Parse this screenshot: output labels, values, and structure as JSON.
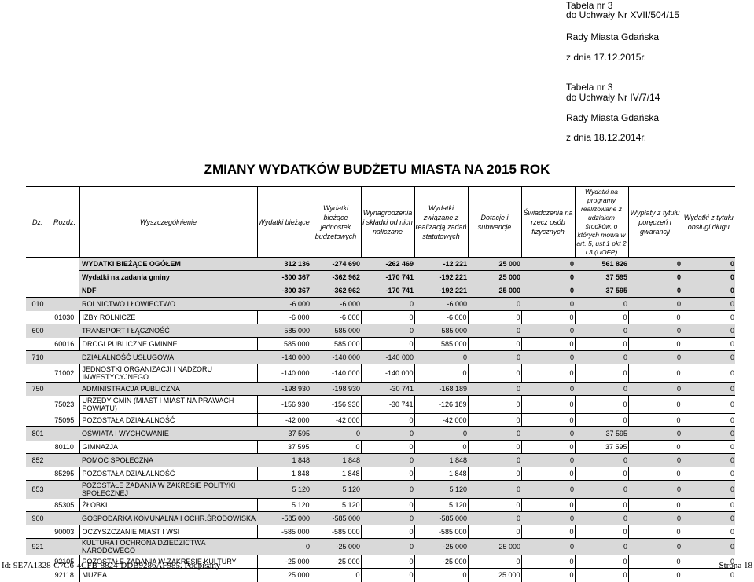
{
  "header": {
    "lines": [
      "Tabela nr 3",
      "do Uchwały Nr XVII/504/15",
      "Rady Miasta Gdańska",
      "z dnia 17.12.2015r.",
      "Tabela nr 3",
      "do Uchwały Nr IV/7/14",
      "Rady Miasta Gdańska",
      "z dnia 18.12.2014r."
    ]
  },
  "title": "ZMIANY WYDATKÓW  BUDŻETU MIASTA NA 2015 ROK",
  "columns": [
    "Dz.",
    "Rozdz.",
    "Wyszczególnienie",
    "Wydatki bieżące",
    "Wydatki bieżące jednostek budżetowych",
    "Wynagrodzenia i składki od nich naliczane",
    "Wydatki związane z realizacją zadań statutowych",
    "Dotacje i subwencje",
    "Świadczenia na rzecz osób fizycznych",
    "Wydatki na programy realizowane z udziałem środków, o których mowa w art. 5, ust.1 pkt 2 i 3 (UOFP)",
    "Wypłaty z tytułu poręczeń i gwarancji",
    "Wydatki z tytułu obsługi długu"
  ],
  "rows": [
    {
      "type": "sum",
      "dz": "",
      "rozdz": "",
      "name": "WYDATKI BIEŻĄCE OGÓŁEM",
      "v": [
        "312 136",
        "-274 690",
        "-262 469",
        "-12 221",
        "25 000",
        "0",
        "561 826",
        "0",
        "0"
      ]
    },
    {
      "type": "sum",
      "dz": "",
      "rozdz": "",
      "name": "Wydatki na zadania gminy",
      "v": [
        "-300 367",
        "-362 962",
        "-170 741",
        "-192 221",
        "25 000",
        "0",
        "37 595",
        "0",
        "0"
      ]
    },
    {
      "type": "sum",
      "dz": "",
      "rozdz": "",
      "name": "NDF",
      "v": [
        "-300 367",
        "-362 962",
        "-170 741",
        "-192 221",
        "25 000",
        "0",
        "37 595",
        "0",
        "0"
      ]
    },
    {
      "type": "sec",
      "dz": "010",
      "rozdz": "",
      "name": "ROLNICTWO I ŁOWIECTWO",
      "v": [
        "-6 000",
        "-6 000",
        "0",
        "-6 000",
        "0",
        "0",
        "0",
        "0",
        "0"
      ]
    },
    {
      "type": "sub",
      "dz": "",
      "rozdz": "01030",
      "name": "IZBY ROLNICZE",
      "v": [
        "-6 000",
        "-6 000",
        "0",
        "-6 000",
        "0",
        "0",
        "0",
        "0",
        "0"
      ]
    },
    {
      "type": "sec",
      "dz": "600",
      "rozdz": "",
      "name": "TRANSPORT I ŁĄCZNOŚĆ",
      "v": [
        "585 000",
        "585 000",
        "0",
        "585 000",
        "0",
        "0",
        "0",
        "0",
        "0"
      ]
    },
    {
      "type": "sub",
      "dz": "",
      "rozdz": "60016",
      "name": "DROGI PUBLICZNE GMINNE",
      "v": [
        "585 000",
        "585 000",
        "0",
        "585 000",
        "0",
        "0",
        "0",
        "0",
        "0"
      ]
    },
    {
      "type": "sec",
      "dz": "710",
      "rozdz": "",
      "name": "DZIAŁALNOŚĆ USŁUGOWA",
      "v": [
        "-140 000",
        "-140 000",
        "-140 000",
        "0",
        "0",
        "0",
        "0",
        "0",
        "0"
      ]
    },
    {
      "type": "sub",
      "dz": "",
      "rozdz": "71002",
      "name": "JEDNOSTKI ORGANIZACJI I NADZORU INWESTYCYJNEGO",
      "v": [
        "-140 000",
        "-140 000",
        "-140 000",
        "0",
        "0",
        "0",
        "0",
        "0",
        "0"
      ]
    },
    {
      "type": "sec",
      "dz": "750",
      "rozdz": "",
      "name": "ADMINISTRACJA PUBLICZNA",
      "v": [
        "-198 930",
        "-198 930",
        "-30 741",
        "-168 189",
        "0",
        "0",
        "0",
        "0",
        "0"
      ]
    },
    {
      "type": "sub",
      "dz": "",
      "rozdz": "75023",
      "name": "URZĘDY GMIN (MIAST I MIAST NA PRAWACH POWIATU)",
      "v": [
        "-156 930",
        "-156 930",
        "-30 741",
        "-126 189",
        "0",
        "0",
        "0",
        "0",
        "0"
      ]
    },
    {
      "type": "sub",
      "dz": "",
      "rozdz": "75095",
      "name": "POZOSTAŁA DZIAŁALNOŚĆ",
      "v": [
        "-42 000",
        "-42 000",
        "0",
        "-42 000",
        "0",
        "0",
        "0",
        "0",
        "0"
      ]
    },
    {
      "type": "sec",
      "dz": "801",
      "rozdz": "",
      "name": "OŚWIATA I WYCHOWANIE",
      "v": [
        "37 595",
        "0",
        "0",
        "0",
        "0",
        "0",
        "37 595",
        "0",
        "0"
      ]
    },
    {
      "type": "sub",
      "dz": "",
      "rozdz": "80110",
      "name": "GIMNAZJA",
      "v": [
        "37 595",
        "0",
        "0",
        "0",
        "0",
        "0",
        "37 595",
        "0",
        "0"
      ]
    },
    {
      "type": "sec",
      "dz": "852",
      "rozdz": "",
      "name": "POMOC SPOŁECZNA",
      "v": [
        "1 848",
        "1 848",
        "0",
        "1 848",
        "0",
        "0",
        "0",
        "0",
        "0"
      ]
    },
    {
      "type": "sub",
      "dz": "",
      "rozdz": "85295",
      "name": "POZOSTAŁA DZIAŁALNOŚĆ",
      "v": [
        "1 848",
        "1 848",
        "0",
        "1 848",
        "0",
        "0",
        "0",
        "0",
        "0"
      ]
    },
    {
      "type": "sec",
      "dz": "853",
      "rozdz": "",
      "name": "POZOSTAŁE ZADANIA W ZAKRESIE POLITYKI SPOŁECZNEJ",
      "v": [
        "5 120",
        "5 120",
        "0",
        "5 120",
        "0",
        "0",
        "0",
        "0",
        "0"
      ]
    },
    {
      "type": "sub",
      "dz": "",
      "rozdz": "85305",
      "name": "ŻŁOBKI",
      "v": [
        "5 120",
        "5 120",
        "0",
        "5 120",
        "0",
        "0",
        "0",
        "0",
        "0"
      ]
    },
    {
      "type": "sec",
      "dz": "900",
      "rozdz": "",
      "name": "GOSPODARKA KOMUNALNA I OCHR.ŚRODOWISKA",
      "v": [
        "-585 000",
        "-585 000",
        "0",
        "-585 000",
        "0",
        "0",
        "0",
        "0",
        "0"
      ]
    },
    {
      "type": "sub",
      "dz": "",
      "rozdz": "90003",
      "name": "OCZYSZCZANIE MIAST I WSI",
      "v": [
        "-585 000",
        "-585 000",
        "0",
        "-585 000",
        "0",
        "0",
        "0",
        "0",
        "0"
      ]
    },
    {
      "type": "sec",
      "dz": "921",
      "rozdz": "",
      "name": "KULTURA I OCHRONA DZIEDZICTWA NARODOWEGO",
      "v": [
        "0",
        "-25 000",
        "0",
        "-25 000",
        "25 000",
        "0",
        "0",
        "0",
        "0"
      ]
    },
    {
      "type": "sub",
      "dz": "",
      "rozdz": "92105",
      "name": "POZOSTAŁE ZADANIA W ZAKRESIE KULTURY",
      "v": [
        "-25 000",
        "-25 000",
        "0",
        "-25 000",
        "0",
        "0",
        "0",
        "0",
        "0"
      ]
    },
    {
      "type": "sub",
      "dz": "",
      "rozdz": "92118",
      "name": "MUZEA",
      "v": [
        "25 000",
        "0",
        "0",
        "0",
        "25 000",
        "0",
        "0",
        "0",
        "0"
      ]
    }
  ],
  "footer": {
    "left": "Id: 9E7A1328-C7C6-4CFB-8824-DDB9286AF985. Podpisany",
    "right": "Strona 18"
  }
}
